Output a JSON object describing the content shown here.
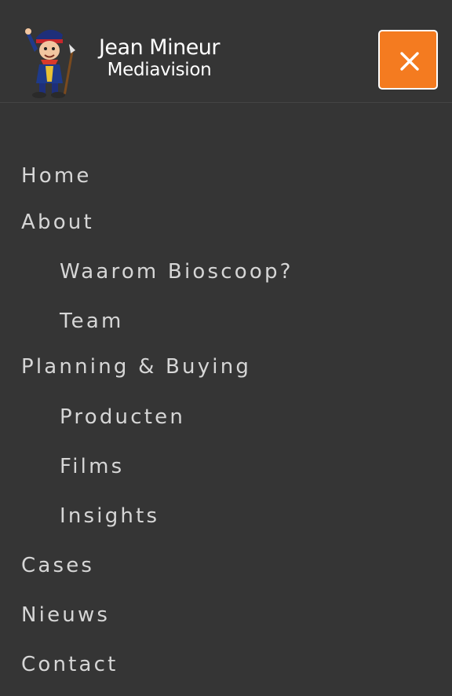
{
  "brand": {
    "line1": "Jean Mineur",
    "line2": "Mediavision",
    "accent_color": "#f47b20",
    "background_color": "#353535"
  },
  "close_button": {
    "icon": "close-icon"
  },
  "menu": {
    "home": "Home",
    "about": "About",
    "waarom_bioscoop": "Waarom Bioscoop?",
    "team": "Team",
    "planning_buying": "Planning & Buying",
    "producten": "Producten",
    "films": "Films",
    "insights": "Insights",
    "cases": "Cases",
    "nieuws": "Nieuws",
    "contact": "Contact"
  }
}
